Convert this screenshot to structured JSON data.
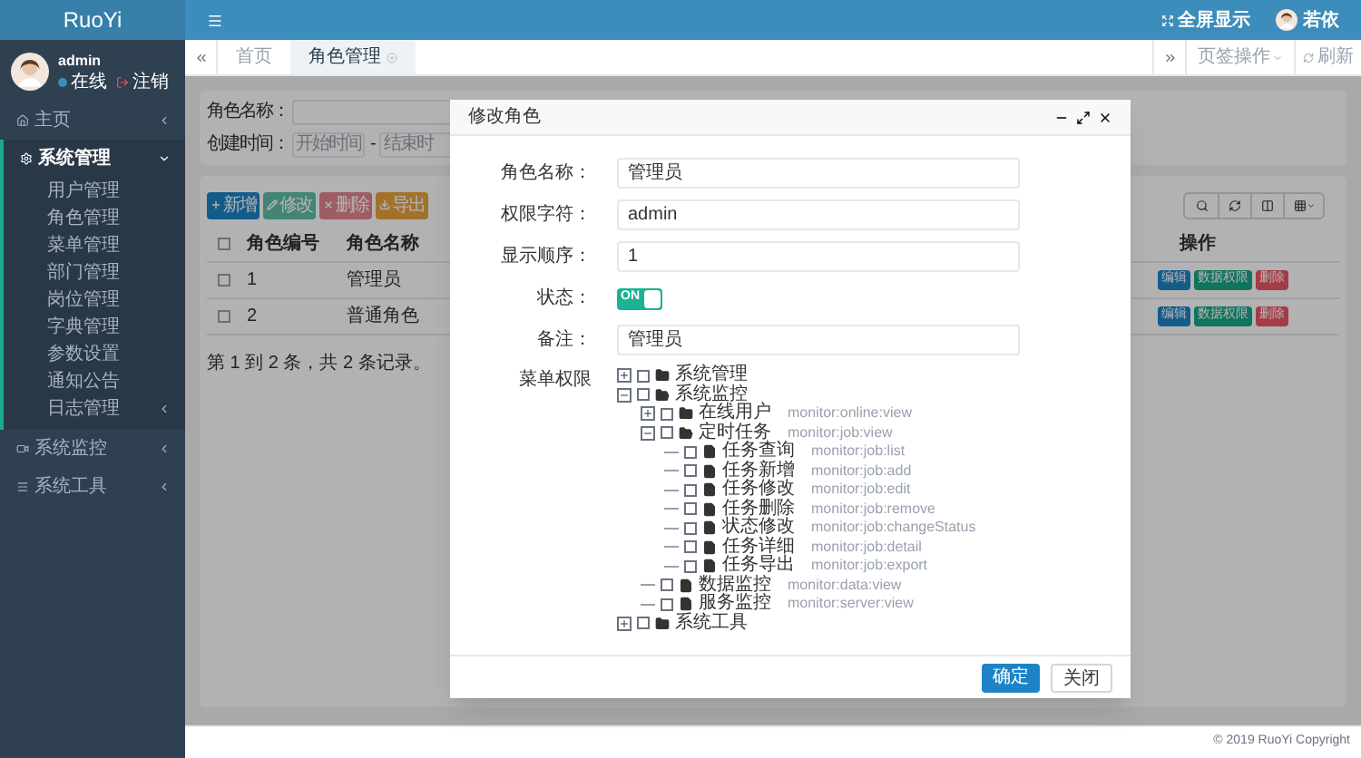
{
  "sidebar": {
    "logo": "RuoYi",
    "user": {
      "name": "admin",
      "status": "在线",
      "logout": "注销"
    },
    "menu": [
      {
        "label": "主页",
        "expanded": false
      },
      {
        "label": "系统管理",
        "expanded": true,
        "children": [
          {
            "label": "用户管理",
            "has_children": false
          },
          {
            "label": "角色管理",
            "has_children": false
          },
          {
            "label": "菜单管理",
            "has_children": false
          },
          {
            "label": "部门管理",
            "has_children": false
          },
          {
            "label": "岗位管理",
            "has_children": false
          },
          {
            "label": "字典管理",
            "has_children": false
          },
          {
            "label": "参数设置",
            "has_children": false
          },
          {
            "label": "通知公告",
            "has_children": false
          },
          {
            "label": "日志管理",
            "has_children": true
          }
        ]
      },
      {
        "label": "系统监控",
        "expanded": false
      },
      {
        "label": "系统工具",
        "expanded": false
      }
    ]
  },
  "topbar": {
    "fullscreen": "全屏显示",
    "user": "若依"
  },
  "tabs": [
    {
      "label": "首页",
      "selected": false
    },
    {
      "label": "角色管理",
      "selected": true
    }
  ],
  "tab_actions": {
    "menu": "页签操作",
    "refresh": "刷新"
  },
  "search": {
    "name_label": "角色名称：",
    "time_label": "创建时间：",
    "start_placeholder": "开始时间",
    "separator": "-",
    "end_placeholder": "结束时"
  },
  "toolbar": [
    {
      "label": "新增",
      "kind": "add"
    },
    {
      "label": "修改",
      "kind": "edit"
    },
    {
      "label": "删除",
      "kind": "delete"
    },
    {
      "label": "导出",
      "kind": "export"
    }
  ],
  "table": {
    "columns": [
      "角色编号",
      "角色名称",
      "操作"
    ],
    "all_checked": false,
    "rows": [
      {
        "id": "1",
        "name": "管理员",
        "checked": false,
        "actions": [
          "编辑",
          "数据权限",
          "删除"
        ]
      },
      {
        "id": "2",
        "name": "普通角色",
        "checked": false,
        "actions": [
          "编辑",
          "数据权限",
          "删除"
        ]
      }
    ],
    "pagination": "第 1 到 2 条，共 2 条记录。"
  },
  "dialog": {
    "title": "修改角色",
    "fields": [
      {
        "label": "角色名称：",
        "kind": "text",
        "value": "管理员"
      },
      {
        "label": "权限字符：",
        "kind": "text",
        "value": "admin"
      },
      {
        "label": "显示顺序：",
        "kind": "text",
        "value": "1"
      },
      {
        "label": "状态：",
        "kind": "switch",
        "on": true,
        "text": "ON"
      },
      {
        "label": "备注：",
        "kind": "text",
        "value": "管理员"
      }
    ],
    "tree_label": "菜单权限",
    "tree": [
      {
        "name": "系统管理",
        "expanded": false,
        "checked": false,
        "folder": true
      },
      {
        "name": "系统监控",
        "expanded": true,
        "checked": false,
        "folder": true,
        "children": [
          {
            "name": "在线用户",
            "perm": "monitor:online:view",
            "expanded": false,
            "checked": false,
            "folder": true
          },
          {
            "name": "定时任务",
            "perm": "monitor:job:view",
            "expanded": true,
            "checked": false,
            "folder": true,
            "children": [
              {
                "name": "任务查询",
                "perm": "monitor:job:list",
                "checked": false
              },
              {
                "name": "任务新增",
                "perm": "monitor:job:add",
                "checked": false
              },
              {
                "name": "任务修改",
                "perm": "monitor:job:edit",
                "checked": false
              },
              {
                "name": "任务删除",
                "perm": "monitor:job:remove",
                "checked": false
              },
              {
                "name": "状态修改",
                "perm": "monitor:job:changeStatus",
                "checked": false
              },
              {
                "name": "任务详细",
                "perm": "monitor:job:detail",
                "checked": false
              },
              {
                "name": "任务导出",
                "perm": "monitor:job:export",
                "checked": false
              }
            ]
          },
          {
            "name": "数据监控",
            "perm": "monitor:data:view",
            "checked": false
          },
          {
            "name": "服务监控",
            "perm": "monitor:server:view",
            "checked": false
          }
        ]
      },
      {
        "name": "系统工具",
        "expanded": false,
        "checked": false,
        "folder": true
      }
    ],
    "buttons": [
      {
        "label": "确定",
        "kind": "primary"
      },
      {
        "label": "关闭",
        "kind": "default"
      }
    ]
  },
  "footer": "© 2019 RuoYi Copyright"
}
